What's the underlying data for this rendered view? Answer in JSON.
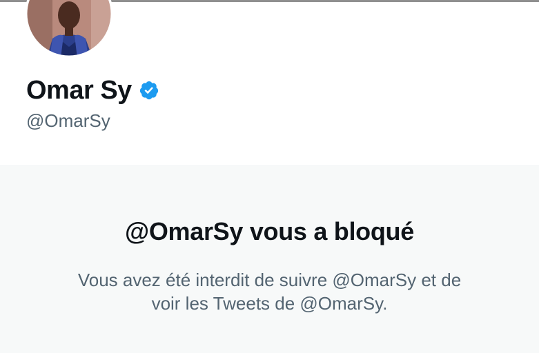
{
  "profile": {
    "name": "Omar Sy",
    "handle": "@OmarSy",
    "verified_badge_color": "#1d9bf0",
    "icons": {
      "verified": "verified-badge-icon",
      "avatar": "profile-photo"
    }
  },
  "blocked": {
    "title": "@OmarSy vous a bloqué",
    "desc_line1": "Vous avez été interdit de suivre @OmarSy et de",
    "desc_line2": "voir les Tweets de @OmarSy."
  },
  "colors": {
    "panel_background": "#f7f9f9",
    "primary_text": "#0f1419",
    "secondary_text": "#536471"
  }
}
